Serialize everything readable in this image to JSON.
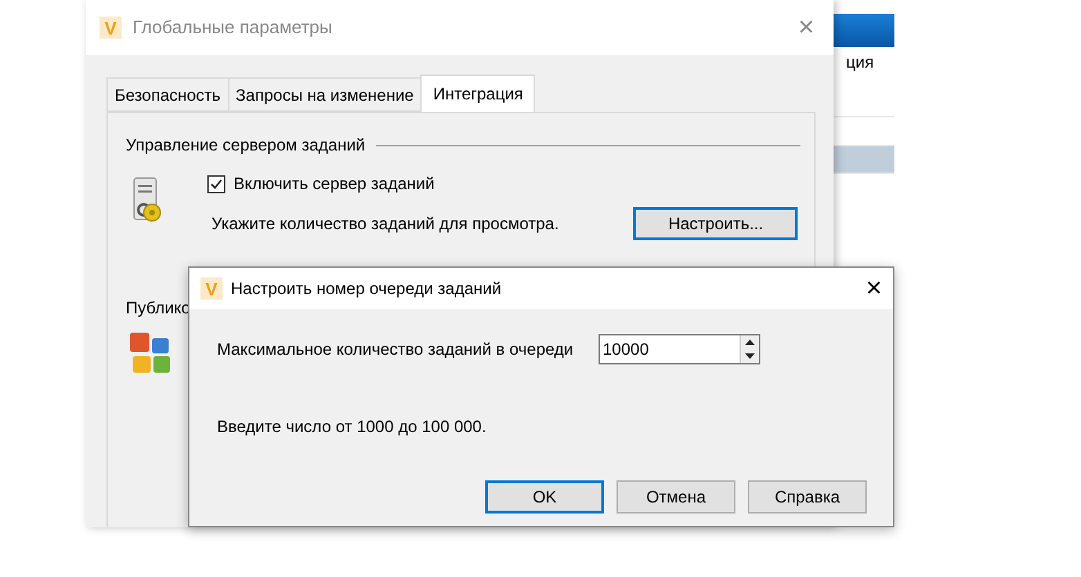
{
  "background_window": {
    "label_fragment": "ция",
    "rows": [
      {
        "selected": false
      },
      {
        "selected": false
      },
      {
        "selected": true
      }
    ]
  },
  "main_dialog": {
    "logo": "V",
    "title": "Глобальные параметры",
    "close": "×",
    "tabs": [
      {
        "label": "Безопасность",
        "selected": false
      },
      {
        "label": "Запросы на изменение",
        "selected": false
      },
      {
        "label": "Интеграция",
        "selected": true
      }
    ],
    "job_server_group": {
      "title": "Управление сервером заданий",
      "checkbox": {
        "label": "Включить сервер заданий",
        "checked": true
      },
      "hint": "Укажите количество заданий для просмотра.",
      "button": "Настроить..."
    },
    "publish_group": {
      "title": "Публико"
    }
  },
  "queue_dialog": {
    "logo": "V",
    "title": "Настроить номер очереди заданий",
    "close": "×",
    "field_label": "Максимальное количество заданий в очереди",
    "value": "10000",
    "hint": "Введите число от 1000 до 100 000.",
    "buttons": [
      {
        "label": "OK",
        "default": true
      },
      {
        "label": "Отмена",
        "default": false
      },
      {
        "label": "Справка",
        "default": false
      }
    ]
  }
}
